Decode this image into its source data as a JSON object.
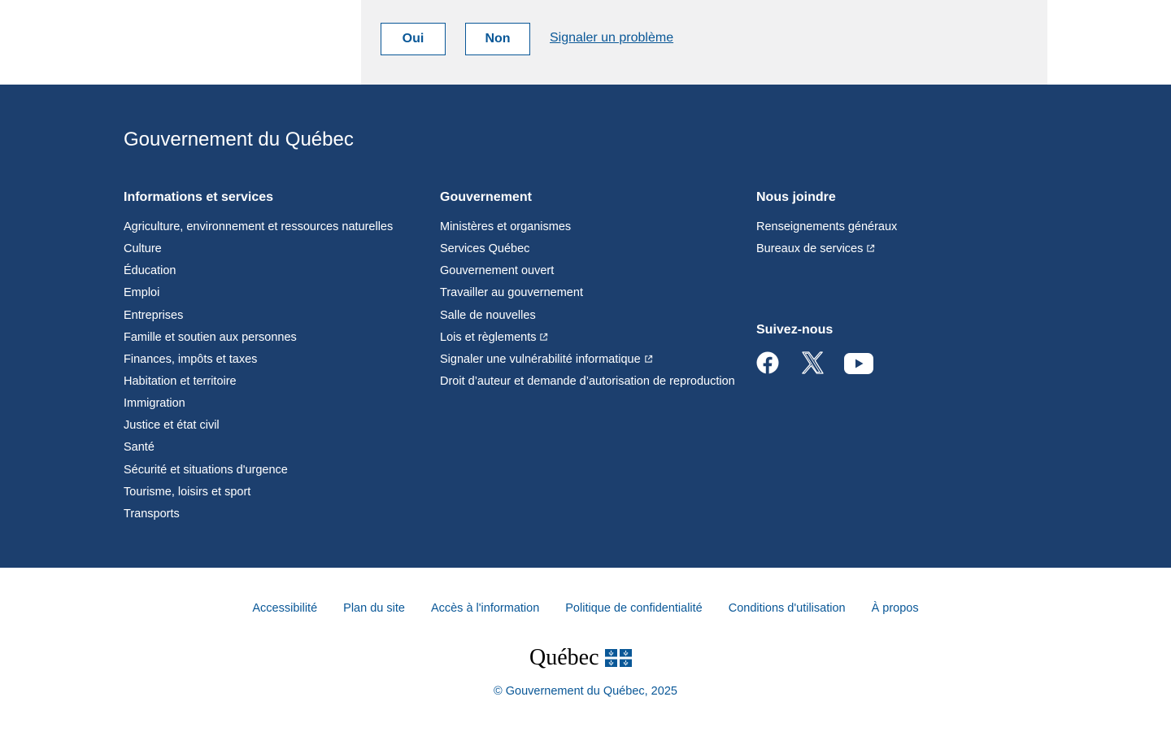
{
  "feedback": {
    "yes_label": "Oui",
    "no_label": "Non",
    "report_label": "Signaler un problème"
  },
  "footer": {
    "title": "Gouvernement du Québec",
    "columns": [
      {
        "heading": "Informations et services",
        "links": [
          "Agriculture, environnement et ressources naturelles",
          "Culture",
          "Éducation",
          "Emploi",
          "Entreprises",
          "Famille et soutien aux personnes",
          "Finances, impôts et taxes",
          "Habitation et territoire",
          "Immigration",
          "Justice et état civil",
          "Santé",
          "Sécurité et situations d'urgence",
          "Tourisme, loisirs et sport",
          "Transports"
        ]
      },
      {
        "heading": "Gouvernement",
        "links": [
          "Ministères et organismes",
          "Services Québec",
          "Gouvernement ouvert",
          "Travailler au gouvernement",
          "Salle de nouvelles",
          "Lois et règlements",
          "Signaler une vulnérabilité informatique",
          "Droit d’auteur et demande d’autorisation de reproduction"
        ]
      },
      {
        "heading": "Nous joindre",
        "links": [
          "Renseignements généraux",
          "Bureaux de services"
        ]
      }
    ],
    "follow_heading": "Suivez-nous",
    "socials": [
      "facebook-icon",
      "x-icon",
      "youtube-icon"
    ]
  },
  "bottom_links": [
    "Accessibilité",
    "Plan du site",
    "Accès à l'information",
    "Politique de confidentialité",
    "Conditions d'utilisation",
    "À propos"
  ],
  "logo_text": "Québec",
  "copyright": "© Gouvernement du Québec, 2025",
  "colors": {
    "footer_bg": "#1c3f6e",
    "link_blue": "#095797",
    "feedback_bg": "#f1f1f2"
  }
}
